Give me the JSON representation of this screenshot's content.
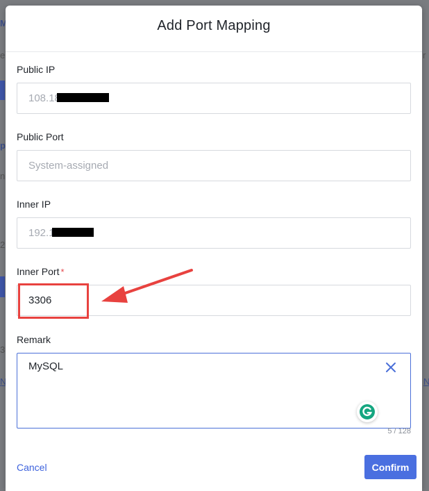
{
  "modal": {
    "title": "Add Port Mapping",
    "cancel_label": "Cancel",
    "confirm_label": "Confirm"
  },
  "fields": {
    "public_ip": {
      "label": "Public IP",
      "value": "108.18"
    },
    "public_port": {
      "label": "Public Port",
      "placeholder": "System-assigned"
    },
    "inner_ip": {
      "label": "Inner IP",
      "value": "192.1"
    },
    "inner_port": {
      "label": "Inner Port",
      "required_mark": "*",
      "value": "3306"
    },
    "remark": {
      "label": "Remark",
      "value": "MySQL",
      "char_count": "5 / 128"
    }
  },
  "colors": {
    "primary": "#4a6fe0",
    "link": "#3e63dd",
    "annotation": "#e8423f",
    "required": "#e5484d"
  },
  "icons": [
    "close-icon",
    "grammarly-icon"
  ]
}
